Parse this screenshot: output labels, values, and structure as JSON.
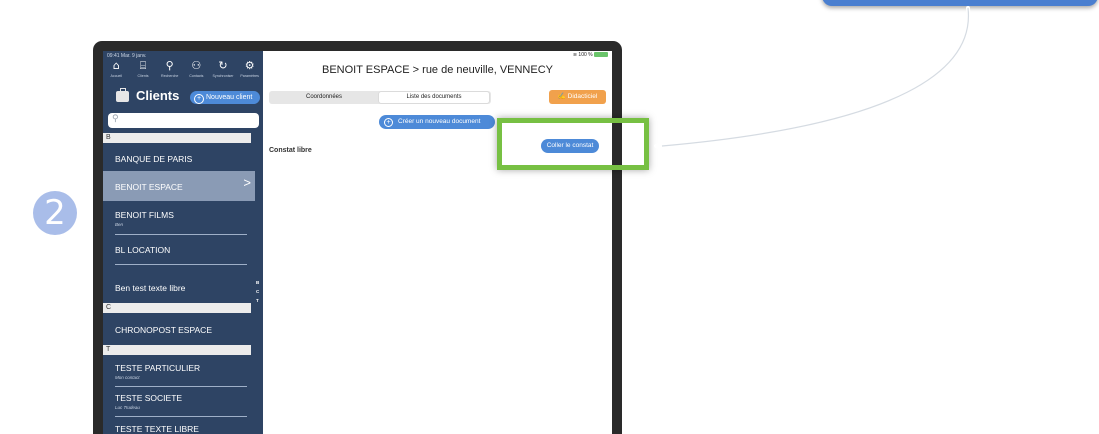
{
  "tablet": {
    "status_time": "09:41  Mar. 9 janv.",
    "status_right": "100 %",
    "tabs": [
      {
        "label": "Accueil",
        "icon": "home-icon"
      },
      {
        "label": "Clients",
        "icon": "briefcase-icon"
      },
      {
        "label": "Recherche",
        "icon": "search-icon"
      },
      {
        "label": "Contacts",
        "icon": "contacts-icon"
      },
      {
        "label": "Synchroniser",
        "icon": "sync-icon"
      },
      {
        "label": "Paramètres",
        "icon": "settings-icon"
      }
    ]
  },
  "sidebar": {
    "title": "Clients",
    "new_client_label": "Nouveau client",
    "search_placeholder": "",
    "sections": {
      "b": "B",
      "c": "C",
      "t": "T"
    },
    "items": [
      {
        "name": "BANQUE DE PARIS",
        "sub": ""
      },
      {
        "name": "BENOIT ESPACE",
        "sub": ""
      },
      {
        "name": "BENOIT FILMS",
        "sub": "Ben"
      },
      {
        "name": "BL LOCATION",
        "sub": ""
      },
      {
        "name": "Ben test texte libre",
        "sub": ""
      },
      {
        "name": "CHRONOPOST ESPACE",
        "sub": ""
      },
      {
        "name": "TESTE PARTICULIER",
        "sub": "Mon contact"
      },
      {
        "name": "TESTE SOCIETE",
        "sub": "Luc Trudeau"
      },
      {
        "name": "TESTE TEXTE LIBRE",
        "sub": ""
      }
    ],
    "selected_chevron": ">",
    "index": [
      "B",
      "C",
      "T"
    ]
  },
  "main": {
    "title": "BENOIT ESPACE > rue de neuville, VENNECY",
    "segments": [
      "Coordonnées",
      "Liste des documents"
    ],
    "active_segment": "Liste des documents",
    "didacticiel_label": "Didacticiel",
    "create_doc_label": "Créer un nouveau document",
    "constat_label": "Constat libre",
    "coller_label": "Coller le constat"
  },
  "overlay": {
    "step_number": "2",
    "highlight_color": "#77c043",
    "pill_color": "#4a7fd0",
    "badge_color": "#a9bde9"
  }
}
